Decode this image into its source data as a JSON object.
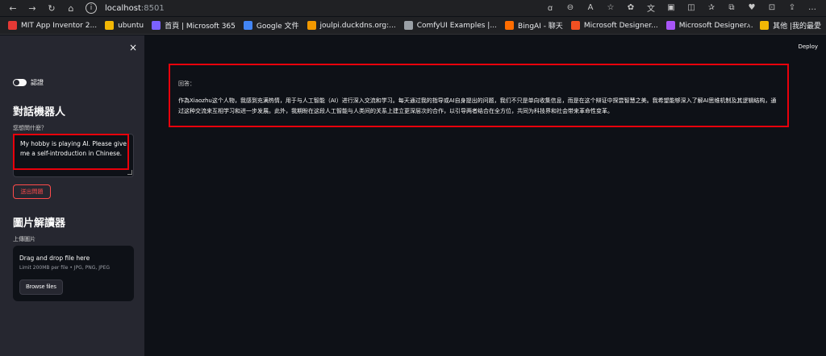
{
  "browser": {
    "url_host": "localhost",
    "url_port": ":8501",
    "bookmarks": [
      {
        "label": "MIT App Inventor 2...",
        "color": "#e53935"
      },
      {
        "label": "ubuntu",
        "color": "#f2b705"
      },
      {
        "label": "首頁 | Microsoft 365",
        "color": "#7b61ff"
      },
      {
        "label": "Google 文件",
        "color": "#4285f4"
      },
      {
        "label": "joulpi.duckdns.org:...",
        "color": "#f29900"
      },
      {
        "label": "ComfyUI Examples |...",
        "color": "#9aa0a6"
      },
      {
        "label": "BingAI - 聊天",
        "color": "#ff6d00"
      },
      {
        "label": "Microsoft Designer...",
        "color": "#f25022"
      },
      {
        "label": "Microsoft Designer...",
        "color": "#a855f7"
      }
    ],
    "bookmarks_other": "其他 |我的最愛"
  },
  "sidebar": {
    "close_icon": "×",
    "toggle_label": "認證",
    "chat_heading": "對話機器人",
    "ask_label": "您想問什麼？",
    "question_value": "My hobby is playing AI. Please give me a self-introduction in Chinese.",
    "send_button": "送出問題",
    "image_heading": "圖片解讀器",
    "upload_label": "上傳圖片",
    "dropzone_title": "Drag and drop file here",
    "dropzone_limit": "Limit 200MB per file • JPG, PNG, JPEG",
    "browse_button": "Browse files"
  },
  "main": {
    "deploy": "Deploy",
    "answer_label": "回答：",
    "answer_text": "作為Xiaozhu这个人物，我感到充满热情，用于与人工智能（AI）进行深入交流和学习。每天通过我的指导或AI自身提出的问题，我们不只是单向收集信息，而是在这个辩证中探尝智慧之美。我希望能够深入了解AI思维机制及其逻辑结构，通过这种交流来互相学习和进一步发展。此外，我期盼在这段人工智能与人类间的关系上建立更深层次的合作，以引导两者结合在全方位，共同为科技界和社会带来革命性变革。"
  },
  "colors": {
    "accent": "#ff4b4b",
    "highlight_box": "#e8000b",
    "sidebar_bg": "#262730",
    "main_bg": "#0e1117"
  }
}
